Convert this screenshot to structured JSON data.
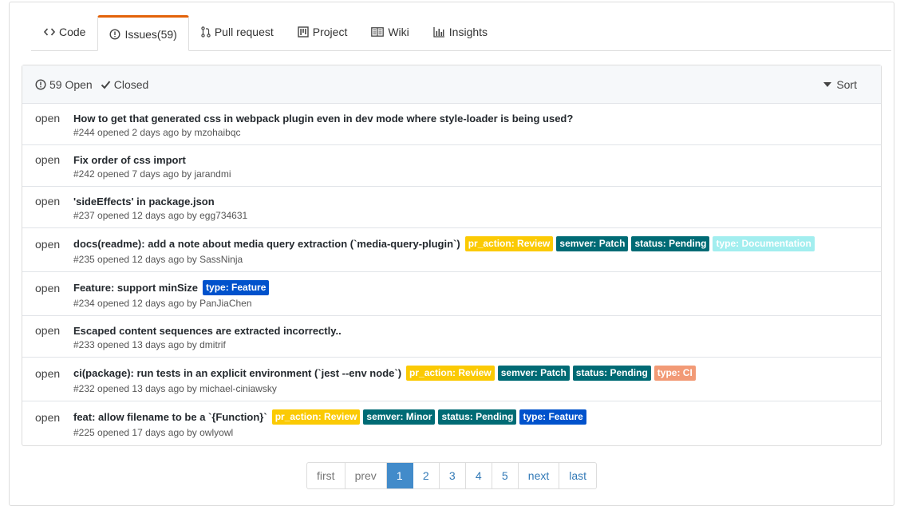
{
  "tabs": [
    {
      "label": "Code",
      "icon": "code-icon"
    },
    {
      "label": "Issues(59)",
      "icon": "issue-opened-icon"
    },
    {
      "label": "Pull request",
      "icon": "git-pull-request-icon"
    },
    {
      "label": "Project",
      "icon": "project-icon"
    },
    {
      "label": "Wiki",
      "icon": "book-icon"
    },
    {
      "label": "Insights",
      "icon": "graph-icon"
    }
  ],
  "filter": {
    "open_label": "59 Open",
    "closed_label": "Closed",
    "sort_label": "Sort"
  },
  "colors": {
    "accent_tab": "#e36209",
    "pr_action": "#fbca04",
    "semver": "#006b75",
    "status": "#006b75",
    "type_documentation": "#a2eeef",
    "type_feature": "#0052cc",
    "type_ci": "#f29a76",
    "pager_active": "#428bca"
  },
  "issues": [
    {
      "status": "open",
      "title": "How to get that generated css in webpack plugin even in dev mode where style-loader is being used?",
      "meta": "#244 opened 2 days ago by mzohaibqc",
      "labels": []
    },
    {
      "status": "open",
      "title": "Fix order of css import",
      "meta": "#242 opened 7 days ago by jarandmi",
      "labels": []
    },
    {
      "status": "open",
      "title": "'sideEffects' in package.json",
      "meta": "#237 opened 12 days ago by egg734631",
      "labels": []
    },
    {
      "status": "open",
      "title": "docs(readme): add a note about media query extraction (`media-query-plugin`)",
      "meta": "#235 opened 12 days ago by SassNinja",
      "labels": [
        {
          "text": "pr_action: Review",
          "color": "#fbca04",
          "fg": "#ffffff"
        },
        {
          "text": "semver: Patch",
          "color": "#006b75",
          "fg": "#ffffff"
        },
        {
          "text": "status: Pending",
          "color": "#006b75",
          "fg": "#ffffff"
        },
        {
          "text": "type: Documentation",
          "color": "#a2eeef",
          "fg": "#ffffff"
        }
      ]
    },
    {
      "status": "open",
      "title": "Feature: support minSize",
      "meta": "#234 opened 12 days ago by PanJiaChen",
      "labels": [
        {
          "text": "type: Feature",
          "color": "#0052cc",
          "fg": "#ffffff"
        }
      ]
    },
    {
      "status": "open",
      "title": "Escaped content sequences are extracted incorrectly..",
      "meta": "#233 opened 13 days ago by dmitrif",
      "labels": []
    },
    {
      "status": "open",
      "title": "ci(package): run tests in an explicit environment (`jest --env node`)",
      "meta": "#232 opened 13 days ago by michael-ciniawsky",
      "labels": [
        {
          "text": "pr_action: Review",
          "color": "#fbca04",
          "fg": "#ffffff"
        },
        {
          "text": "semver: Patch",
          "color": "#006b75",
          "fg": "#ffffff"
        },
        {
          "text": "status: Pending",
          "color": "#006b75",
          "fg": "#ffffff"
        },
        {
          "text": "type: CI",
          "color": "#f29a76",
          "fg": "#ffffff"
        }
      ]
    },
    {
      "status": "open",
      "title": "feat: allow filename to be a `{Function}`",
      "meta": "#225 opened 17 days ago by owlyowl",
      "labels": [
        {
          "text": "pr_action: Review",
          "color": "#fbca04",
          "fg": "#ffffff"
        },
        {
          "text": "semver: Minor",
          "color": "#006b75",
          "fg": "#ffffff"
        },
        {
          "text": "status: Pending",
          "color": "#006b75",
          "fg": "#ffffff"
        },
        {
          "text": "type: Feature",
          "color": "#0052cc",
          "fg": "#ffffff"
        }
      ]
    }
  ],
  "pagination": {
    "first": "first",
    "prev": "prev",
    "pages": [
      "1",
      "2",
      "3",
      "4",
      "5"
    ],
    "current": "1",
    "next": "next",
    "last": "last"
  }
}
